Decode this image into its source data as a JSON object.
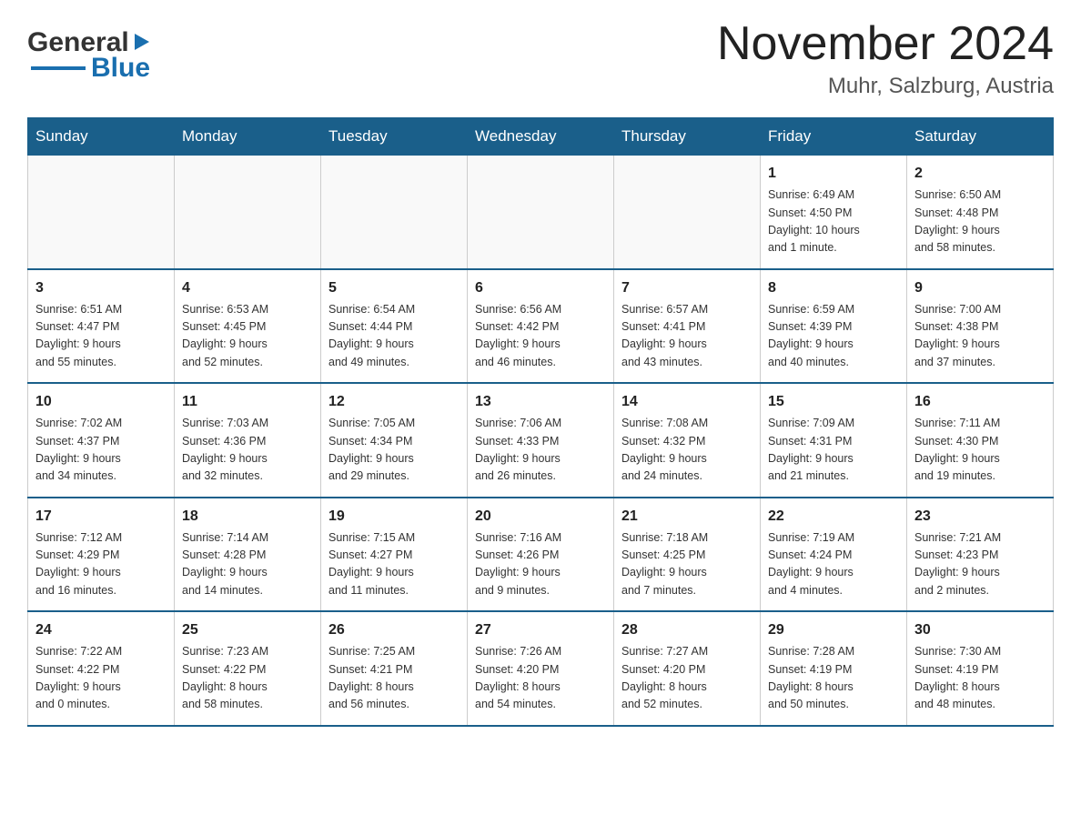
{
  "header": {
    "logo": {
      "general": "General",
      "triangle": "▶",
      "blue": "Blue"
    },
    "title": "November 2024",
    "location": "Muhr, Salzburg, Austria"
  },
  "calendar": {
    "days_of_week": [
      "Sunday",
      "Monday",
      "Tuesday",
      "Wednesday",
      "Thursday",
      "Friday",
      "Saturday"
    ],
    "weeks": [
      {
        "days": [
          {
            "number": "",
            "info": ""
          },
          {
            "number": "",
            "info": ""
          },
          {
            "number": "",
            "info": ""
          },
          {
            "number": "",
            "info": ""
          },
          {
            "number": "",
            "info": ""
          },
          {
            "number": "1",
            "info": "Sunrise: 6:49 AM\nSunset: 4:50 PM\nDaylight: 10 hours\nand 1 minute."
          },
          {
            "number": "2",
            "info": "Sunrise: 6:50 AM\nSunset: 4:48 PM\nDaylight: 9 hours\nand 58 minutes."
          }
        ]
      },
      {
        "days": [
          {
            "number": "3",
            "info": "Sunrise: 6:51 AM\nSunset: 4:47 PM\nDaylight: 9 hours\nand 55 minutes."
          },
          {
            "number": "4",
            "info": "Sunrise: 6:53 AM\nSunset: 4:45 PM\nDaylight: 9 hours\nand 52 minutes."
          },
          {
            "number": "5",
            "info": "Sunrise: 6:54 AM\nSunset: 4:44 PM\nDaylight: 9 hours\nand 49 minutes."
          },
          {
            "number": "6",
            "info": "Sunrise: 6:56 AM\nSunset: 4:42 PM\nDaylight: 9 hours\nand 46 minutes."
          },
          {
            "number": "7",
            "info": "Sunrise: 6:57 AM\nSunset: 4:41 PM\nDaylight: 9 hours\nand 43 minutes."
          },
          {
            "number": "8",
            "info": "Sunrise: 6:59 AM\nSunset: 4:39 PM\nDaylight: 9 hours\nand 40 minutes."
          },
          {
            "number": "9",
            "info": "Sunrise: 7:00 AM\nSunset: 4:38 PM\nDaylight: 9 hours\nand 37 minutes."
          }
        ]
      },
      {
        "days": [
          {
            "number": "10",
            "info": "Sunrise: 7:02 AM\nSunset: 4:37 PM\nDaylight: 9 hours\nand 34 minutes."
          },
          {
            "number": "11",
            "info": "Sunrise: 7:03 AM\nSunset: 4:36 PM\nDaylight: 9 hours\nand 32 minutes."
          },
          {
            "number": "12",
            "info": "Sunrise: 7:05 AM\nSunset: 4:34 PM\nDaylight: 9 hours\nand 29 minutes."
          },
          {
            "number": "13",
            "info": "Sunrise: 7:06 AM\nSunset: 4:33 PM\nDaylight: 9 hours\nand 26 minutes."
          },
          {
            "number": "14",
            "info": "Sunrise: 7:08 AM\nSunset: 4:32 PM\nDaylight: 9 hours\nand 24 minutes."
          },
          {
            "number": "15",
            "info": "Sunrise: 7:09 AM\nSunset: 4:31 PM\nDaylight: 9 hours\nand 21 minutes."
          },
          {
            "number": "16",
            "info": "Sunrise: 7:11 AM\nSunset: 4:30 PM\nDaylight: 9 hours\nand 19 minutes."
          }
        ]
      },
      {
        "days": [
          {
            "number": "17",
            "info": "Sunrise: 7:12 AM\nSunset: 4:29 PM\nDaylight: 9 hours\nand 16 minutes."
          },
          {
            "number": "18",
            "info": "Sunrise: 7:14 AM\nSunset: 4:28 PM\nDaylight: 9 hours\nand 14 minutes."
          },
          {
            "number": "19",
            "info": "Sunrise: 7:15 AM\nSunset: 4:27 PM\nDaylight: 9 hours\nand 11 minutes."
          },
          {
            "number": "20",
            "info": "Sunrise: 7:16 AM\nSunset: 4:26 PM\nDaylight: 9 hours\nand 9 minutes."
          },
          {
            "number": "21",
            "info": "Sunrise: 7:18 AM\nSunset: 4:25 PM\nDaylight: 9 hours\nand 7 minutes."
          },
          {
            "number": "22",
            "info": "Sunrise: 7:19 AM\nSunset: 4:24 PM\nDaylight: 9 hours\nand 4 minutes."
          },
          {
            "number": "23",
            "info": "Sunrise: 7:21 AM\nSunset: 4:23 PM\nDaylight: 9 hours\nand 2 minutes."
          }
        ]
      },
      {
        "days": [
          {
            "number": "24",
            "info": "Sunrise: 7:22 AM\nSunset: 4:22 PM\nDaylight: 9 hours\nand 0 minutes."
          },
          {
            "number": "25",
            "info": "Sunrise: 7:23 AM\nSunset: 4:22 PM\nDaylight: 8 hours\nand 58 minutes."
          },
          {
            "number": "26",
            "info": "Sunrise: 7:25 AM\nSunset: 4:21 PM\nDaylight: 8 hours\nand 56 minutes."
          },
          {
            "number": "27",
            "info": "Sunrise: 7:26 AM\nSunset: 4:20 PM\nDaylight: 8 hours\nand 54 minutes."
          },
          {
            "number": "28",
            "info": "Sunrise: 7:27 AM\nSunset: 4:20 PM\nDaylight: 8 hours\nand 52 minutes."
          },
          {
            "number": "29",
            "info": "Sunrise: 7:28 AM\nSunset: 4:19 PM\nDaylight: 8 hours\nand 50 minutes."
          },
          {
            "number": "30",
            "info": "Sunrise: 7:30 AM\nSunset: 4:19 PM\nDaylight: 8 hours\nand 48 minutes."
          }
        ]
      }
    ]
  }
}
